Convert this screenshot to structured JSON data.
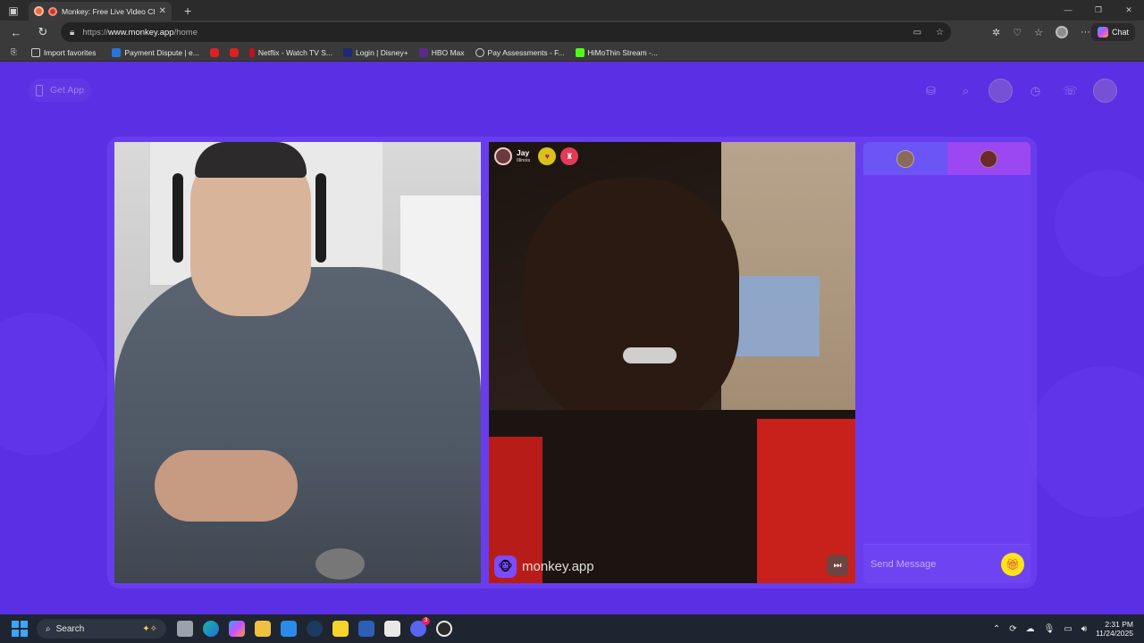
{
  "browser": {
    "tab_title": "Monkey: Free Live Video Chat",
    "url_scheme": "https://",
    "url_host": "www.monkey.app",
    "url_path": "/home",
    "chat_label": "Chat",
    "new_tab_icon": "plus-icon"
  },
  "favorites": [
    {
      "label": "Import favorites",
      "icon": "import-icon",
      "color": "#cfcfcf"
    },
    {
      "label": "Payment Dispute | e...",
      "icon": "payment-icon",
      "color": "#2d74d9"
    },
    {
      "label": "",
      "icon": "youtube-icon",
      "color": "#e02020"
    },
    {
      "label": "",
      "icon": "youtube-icon",
      "color": "#e02020"
    },
    {
      "label": "Netflix - Watch TV S...",
      "icon": "netflix-icon",
      "color": "#c1121f"
    },
    {
      "label": "Login | Disney+",
      "icon": "disney-icon",
      "color": "#1e2a78"
    },
    {
      "label": "HBO Max",
      "icon": "hbo-icon",
      "color": "#5a2a8a"
    },
    {
      "label": "Pay Assessments - F...",
      "icon": "globe-icon",
      "color": "#9aa0a6"
    },
    {
      "label": "HiMoThin Stream -...",
      "icon": "kick-icon",
      "color": "#53fc18"
    }
  ],
  "page": {
    "get_app_label": "Get App"
  },
  "peer": {
    "name": "Jay",
    "location": "Illinois"
  },
  "brand": {
    "text": "monkey.app"
  },
  "chat": {
    "placeholder": "Send Message"
  },
  "taskbar": {
    "search_label": "Search",
    "time": "2:31 PM",
    "date": "11/24/2025",
    "discord_badge": "3"
  }
}
